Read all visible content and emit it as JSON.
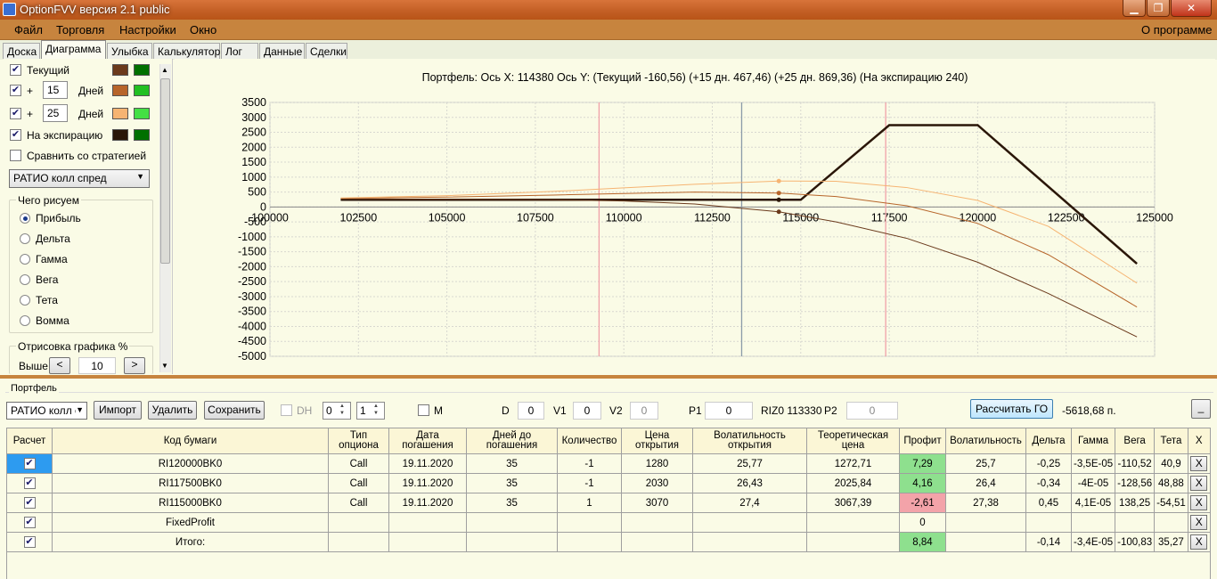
{
  "window": {
    "title": "OptionFVV версия 2.1 public",
    "min": "▁",
    "max": "❐",
    "close": "✕"
  },
  "menu": {
    "items": [
      "Файл",
      "Торговля",
      "Настройки",
      "Окно"
    ],
    "about": "О программе"
  },
  "tabs": [
    "Доска",
    "Диаграмма",
    "Улыбка",
    "Калькулятор",
    "Лог",
    "Данные",
    "Сделки"
  ],
  "left": {
    "current_label": "Текущий",
    "plus": "+",
    "days1": "15",
    "days2": "25",
    "days_label": "Дней",
    "expiry_label": "На экспирацию",
    "compare_label": "Сравнить со стратегией",
    "strategy": "РАТИО колл спред",
    "draw_group": "Чего рисуем",
    "draw_options": [
      "Прибыль",
      "Дельта",
      "Гамма",
      "Вега",
      "Тета",
      "Вомма"
    ],
    "render_group": "Отрисовка графика %",
    "higher": "Выше",
    "render_value": "10",
    "colors": {
      "current": [
        "#6b3a1c",
        "#007000"
      ],
      "d15": [
        "#b7652a",
        "#22c022"
      ],
      "d25": [
        "#f6b472",
        "#44e044"
      ],
      "expiry": [
        "#2a1608",
        "#007000"
      ]
    }
  },
  "chart_data": {
    "type": "line",
    "title": "Портфель: Ось X:  114380 Ось Y:   (Текущий -160,56)  (+15 дн. 467,46)  (+25 дн. 869,36)  (На экспирацию 240)",
    "xlim": [
      100000,
      125000
    ],
    "ylim": [
      -5000,
      3500
    ],
    "x_ticks": [
      "100000",
      "102500",
      "105000",
      "107500",
      "110000",
      "112500",
      "115000",
      "117500",
      "120000",
      "122500",
      "125000"
    ],
    "y_ticks": [
      "3500",
      "3000",
      "2500",
      "2000",
      "1500",
      "1000",
      "500",
      "0",
      "-500",
      "-1000",
      "-1500",
      "-2000",
      "-2500",
      "-3000",
      "-3500",
      "-4000",
      "-4500",
      "-5000"
    ],
    "vlines": [
      {
        "x": 109300,
        "color": "#f0a0a8"
      },
      {
        "x": 113330,
        "color": "#8a9aa8"
      },
      {
        "x": 117400,
        "color": "#f0a0a8"
      }
    ],
    "series": [
      {
        "color": "#2a1608",
        "width": 2.5,
        "x": [
          102000,
          115000,
          117500,
          120000,
          124500
        ],
        "y": [
          240,
          240,
          2740,
          2740,
          -1900
        ]
      },
      {
        "color": "#6b3a1c",
        "width": 1,
        "x": [
          102000,
          105000,
          108000,
          110000,
          112000,
          114380,
          116000,
          118000,
          120000,
          122000,
          124500
        ],
        "y": [
          270,
          260,
          240,
          200,
          100,
          -160,
          -500,
          -1050,
          -1850,
          -2900,
          -4350
        ]
      },
      {
        "color": "#b7652a",
        "width": 1,
        "x": [
          102000,
          105000,
          108000,
          110000,
          112000,
          114380,
          116000,
          118000,
          120000,
          122000,
          124500
        ],
        "y": [
          290,
          330,
          400,
          450,
          500,
          467,
          350,
          40,
          -550,
          -1600,
          -3350
        ]
      },
      {
        "color": "#f6b472",
        "width": 1,
        "x": [
          102000,
          105000,
          108000,
          110000,
          112000,
          114380,
          116000,
          118000,
          120000,
          122000,
          124500
        ],
        "y": [
          300,
          380,
          520,
          640,
          760,
          869,
          860,
          650,
          220,
          -650,
          -2550
        ]
      }
    ],
    "markers": [
      {
        "x": 114380,
        "y": 240,
        "color": "#2a1608"
      },
      {
        "x": 114380,
        "y": -160,
        "color": "#6b3a1c"
      },
      {
        "x": 114380,
        "y": 467,
        "color": "#b7652a"
      },
      {
        "x": 114380,
        "y": 869,
        "color": "#f6b472"
      }
    ]
  },
  "portfolio": {
    "label": "Портфель",
    "select": "РАТИО колл с",
    "import": "Импорт",
    "delete": "Удалить",
    "save": "Сохранить",
    "dh": "DH",
    "spin1": "0",
    "spin2": "1",
    "m": "M",
    "d_label": "D",
    "d_value": "0",
    "v1_label": "V1",
    "v1_value": "0",
    "v2_label": "V2",
    "v2_value": "0",
    "p1_label": "P1",
    "p1_value": "0",
    "riz": "RIZ0 113330",
    "p2_label": "P2",
    "p2_value": "0",
    "calc": "Рассчитать ГО",
    "go_value": "-5618,68 п.",
    "collapse": "_"
  },
  "table": {
    "headers": [
      "Расчет",
      "Код бумаги",
      "Тип опциона",
      "Дата погашения",
      "Дней до погашения",
      "Количество",
      "Цена открытия",
      "Волатильность открытия",
      "Теоретическая цена",
      "Профит",
      "Волатильность",
      "Дельта",
      "Гамма",
      "Вега",
      "Тета",
      "X"
    ],
    "rows": [
      [
        "✔",
        "RI120000BK0",
        "Call",
        "19.11.2020",
        "35",
        "-1",
        "1280",
        "25,77",
        "1272,71",
        "7,29",
        "25,7",
        "-0,25",
        "-3,5E-05",
        "-110,52",
        "40,9",
        "X"
      ],
      [
        "✔",
        "RI117500BK0",
        "Call",
        "19.11.2020",
        "35",
        "-1",
        "2030",
        "26,43",
        "2025,84",
        "4,16",
        "26,4",
        "-0,34",
        "-4E-05",
        "-128,56",
        "48,88",
        "X"
      ],
      [
        "✔",
        "RI115000BK0",
        "Call",
        "19.11.2020",
        "35",
        "1",
        "3070",
        "27,4",
        "3067,39",
        "-2,61",
        "27,38",
        "0,45",
        "4,1E-05",
        "138,25",
        "-54,51",
        "X"
      ],
      [
        "✔",
        "FixedProfit",
        "",
        "",
        "",
        "",
        "",
        "",
        "",
        "0",
        "",
        "",
        "",
        "",
        "",
        "X"
      ],
      [
        "✔",
        "Итого:",
        "",
        "",
        "",
        "",
        "",
        "",
        "",
        "8,84",
        "",
        "-0,14",
        "-3,4E-05",
        "-100,83",
        "35,27",
        "X"
      ]
    ]
  }
}
